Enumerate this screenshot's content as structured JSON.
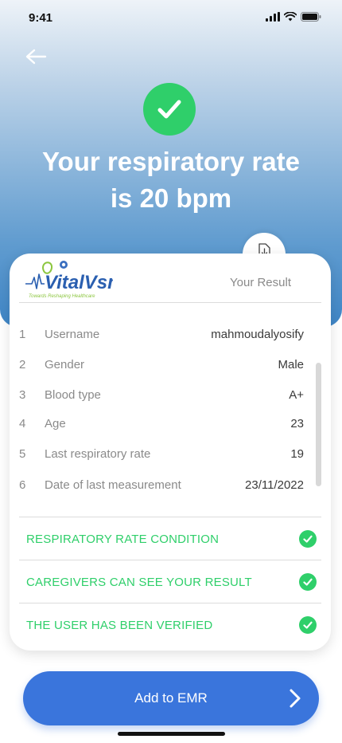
{
  "status": {
    "time": "9:41"
  },
  "headline": {
    "line1": "Your respiratory rate",
    "line2": "is 20 bpm"
  },
  "card": {
    "result_label": "Your Result",
    "logo_text": "VitalVsm",
    "logo_tagline": "Towards Reshaping Healthcare",
    "rows": [
      {
        "num": "1",
        "label": "Username",
        "value": "mahmoudalyosify"
      },
      {
        "num": "2",
        "label": "Gender",
        "value": "Male"
      },
      {
        "num": "3",
        "label": "Blood type",
        "value": "A+"
      },
      {
        "num": "4",
        "label": "Age",
        "value": "23"
      },
      {
        "num": "5",
        "label": "Last respiratory rate",
        "value": "19"
      },
      {
        "num": "6",
        "label": "Date of last measurement",
        "value": "23/11/2022"
      }
    ],
    "conditions": [
      {
        "label": "RESPIRATORY RATE CONDITION"
      },
      {
        "label": "CAREGIVERS CAN SEE YOUR RESULT"
      },
      {
        "label": "THE USER HAS BEEN VERIFIED"
      }
    ]
  },
  "cta": {
    "label": "Add to EMR"
  },
  "icons": {
    "back": "arrow-left-icon",
    "success": "check-circle-icon",
    "download": "download-icon",
    "next": "chevron-right-icon"
  },
  "colors": {
    "accent_green": "#2fcf6a",
    "primary_blue": "#3a75dc",
    "hero_blue": "#3f86c7"
  }
}
